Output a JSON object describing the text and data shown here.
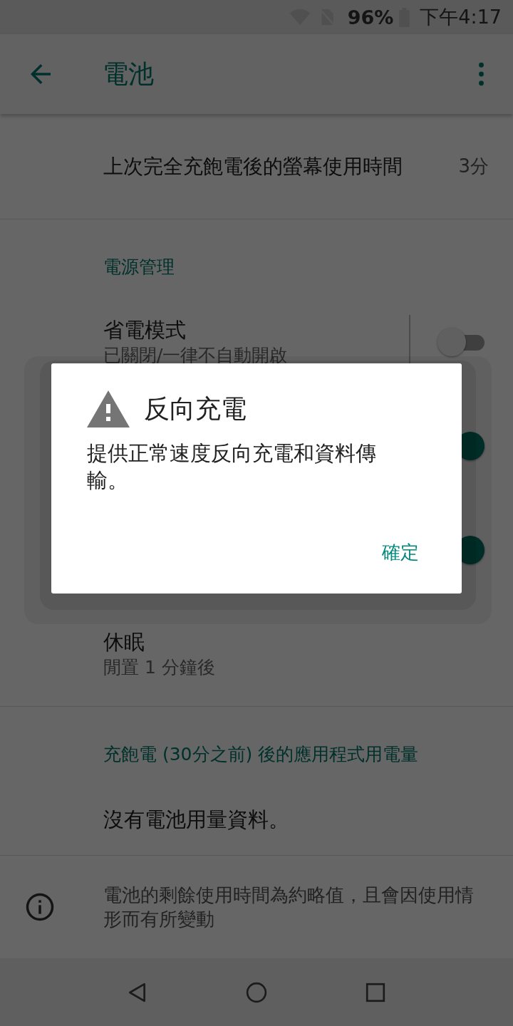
{
  "status_bar": {
    "battery": "96%",
    "time": "下午4:17"
  },
  "app_bar": {
    "title": "電池"
  },
  "screen_time": {
    "label": "上次完全充飽電後的螢幕使用時間",
    "value": "3分"
  },
  "power_section": {
    "header": "電源管理",
    "items": [
      {
        "kind": "switch",
        "title": "省電模式",
        "subtitle": "已關閉/一律不自動開啟",
        "on": false
      },
      {
        "kind": "switch",
        "on": true
      },
      {
        "kind": "switch",
        "on": true
      },
      {
        "kind": "text",
        "title": "休眠",
        "subtitle": "閒置 1 分鐘後"
      }
    ]
  },
  "usage_section": {
    "header": "充飽電 (30分之前) 後的應用程式用電量",
    "message": "沒有電池用量資料。"
  },
  "info_note": "電池的剩餘使用時間為約略值，且會因使用情形而有所變動",
  "dialog": {
    "title": "反向充電",
    "message": "提供正常速度反向充電和資料傳輸。",
    "button": "確定"
  }
}
